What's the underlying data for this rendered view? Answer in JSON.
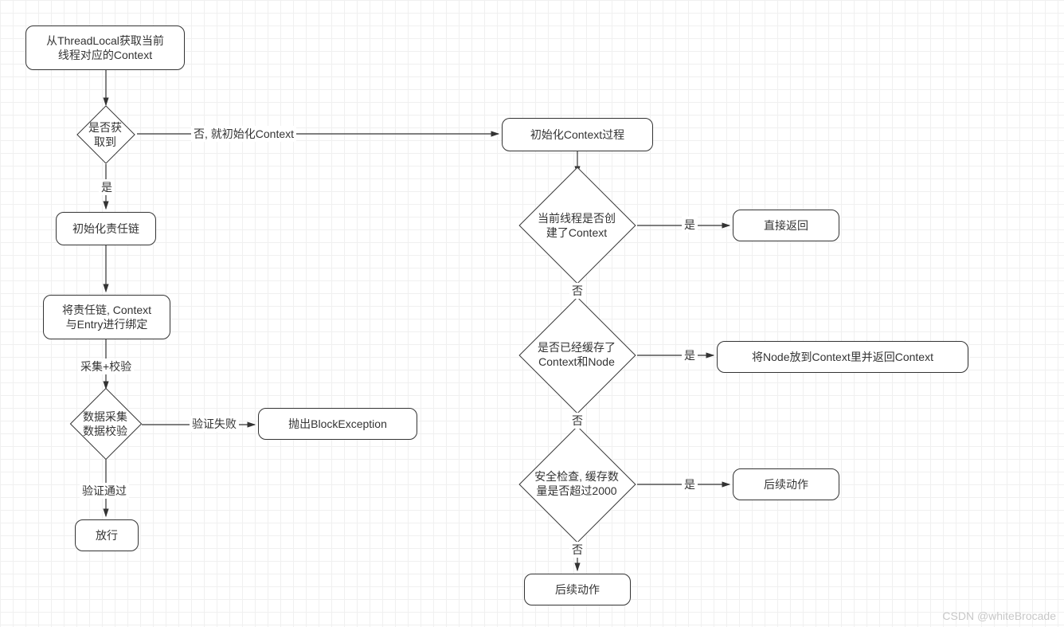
{
  "flow": {
    "left": {
      "start": "从ThreadLocal获取当前\n线程对应的Context",
      "d_got": "是否获\n取到",
      "init_chain": "初始化责任链",
      "bind": "将责任链, Context\n与Entry进行绑定",
      "d_data": "数据采集\n数据校验",
      "throw": "抛出BlockException",
      "pass": "放行"
    },
    "right": {
      "init_ctx": "初始化Context过程",
      "d_created": "当前线程是否创\n建了Context",
      "ret_direct": "直接返回",
      "d_cached": "是否已经缓存了\nContext和Node",
      "node_put": "将Node放到Context里并返回Context",
      "d_safe": "安全检查, 缓存数\n量是否超过2000",
      "follow1": "后续动作",
      "follow2": "后续动作"
    },
    "labels": {
      "yes": "是",
      "no": "否",
      "no_init_context": "否, 就初始化Context",
      "collect_check": "采集+校验",
      "verify_fail": "验证失败",
      "verify_pass": "验证通过"
    }
  },
  "watermark": "CSDN @whiteBrocade"
}
